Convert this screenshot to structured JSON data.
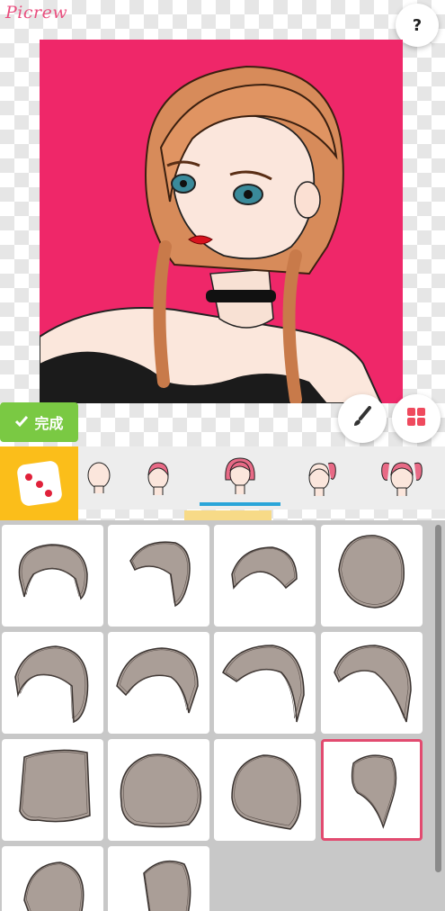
{
  "app": {
    "logo": "Picrew"
  },
  "header": {
    "help_label": "?"
  },
  "toolbar": {
    "done_label": "完成",
    "brush_icon": "paintbrush-icon",
    "grid_icon": "grid-icon"
  },
  "colors": {
    "accent": "#e94f7f",
    "canvas_bg": "#ef2769",
    "done": "#7ac943",
    "dice_bg": "#fbbe1a",
    "tab_active": "#2aa5d9",
    "selected_border": "#e24b70"
  },
  "tabs": [
    {
      "name": "tab-hair-1",
      "icon": "head-bald-icon"
    },
    {
      "name": "tab-hair-2",
      "icon": "head-short-pink-hair-icon"
    },
    {
      "name": "tab-hair-3",
      "icon": "head-bob-pink-hair-icon",
      "active": true
    },
    {
      "name": "tab-hair-4",
      "icon": "head-ponytail-icon"
    },
    {
      "name": "tab-hair-5",
      "icon": "head-twin-tails-icon"
    }
  ],
  "hair_options": {
    "count": 14,
    "selected_index": 11
  }
}
